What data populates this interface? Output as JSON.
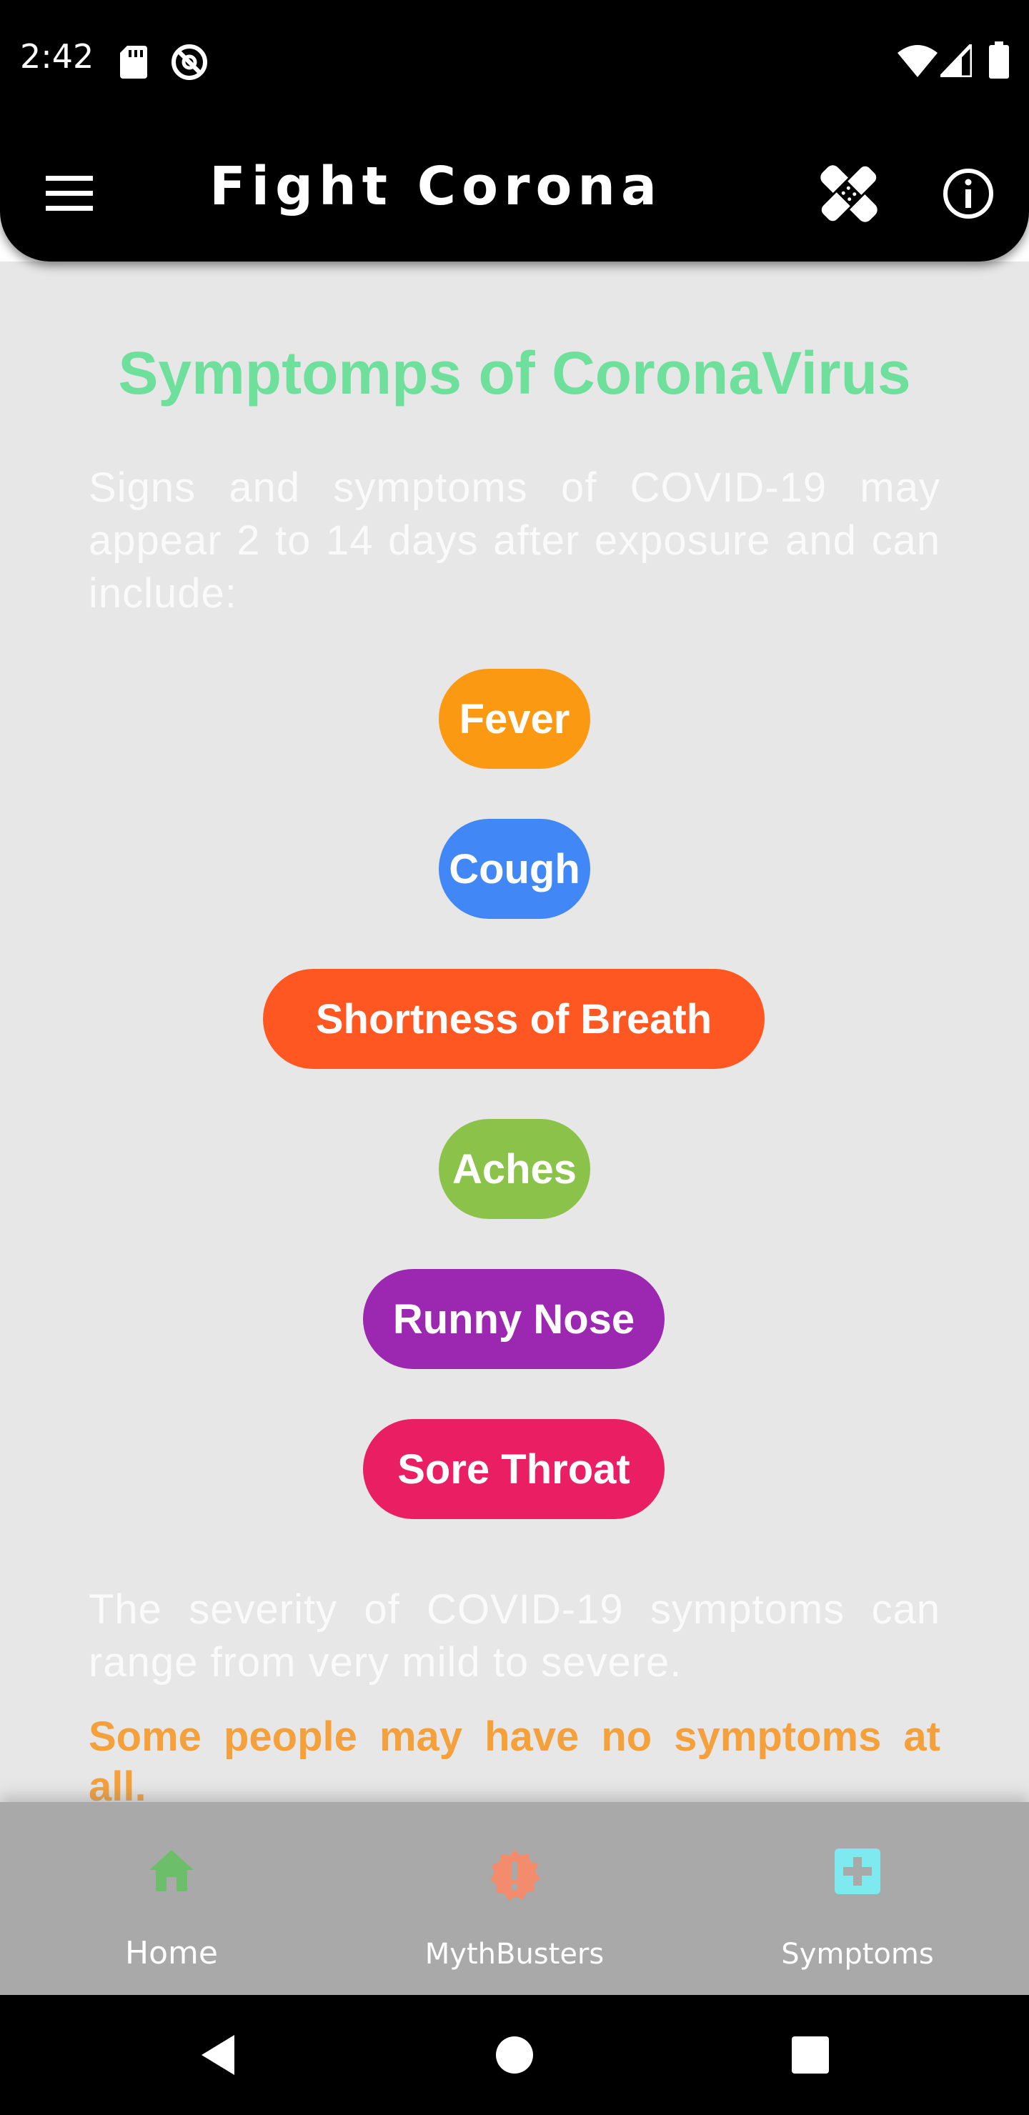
{
  "status_bar": {
    "time": "2:42"
  },
  "app_bar": {
    "title": "Fight Corona"
  },
  "content": {
    "heading": "Symptomps of CoronaVirus",
    "intro": "Signs and symptoms of COVID-19 may appear 2 to 14 days after exposure and can include:",
    "symptoms": [
      {
        "label": "Fever",
        "color": "#fb9a12"
      },
      {
        "label": "Cough",
        "color": "#4187f5"
      },
      {
        "label": "Shortness of Breath",
        "color": "#fe5722"
      },
      {
        "label": "Aches",
        "color": "#8bc34a"
      },
      {
        "label": "Runny Nose",
        "color": "#9c27b0"
      },
      {
        "label": "Sore Throat",
        "color": "#e91e63"
      }
    ],
    "severity": "The severity of COVID-19 symptoms can range from very mild to severe.",
    "no_symptoms": "Some people may have no symptoms at all."
  },
  "bottom_nav": {
    "items": [
      {
        "label": "Home",
        "icon": "home-icon",
        "color": "#6dbe6a",
        "active": true
      },
      {
        "label": "MythBusters",
        "icon": "alert-badge-icon",
        "color": "#f28c6c",
        "active": false
      },
      {
        "label": "Symptoms",
        "icon": "medical-plus-icon",
        "color": "#7eeaf0",
        "active": false
      }
    ]
  }
}
